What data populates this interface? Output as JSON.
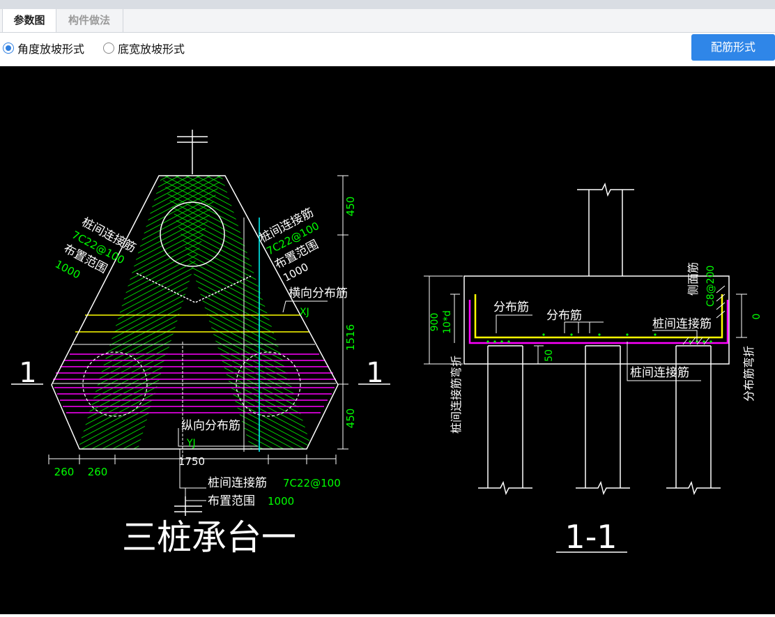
{
  "tabs": {
    "params": "参数图",
    "method": "构件做法"
  },
  "options": {
    "angle": "角度放坡形式",
    "width": "底宽放坡形式"
  },
  "button": {
    "rebar": "配筋形式"
  },
  "plan": {
    "tie_left_1": "桩间连接筋",
    "tie_left_2": "7C22@100",
    "tie_left_3": "布置范围",
    "tie_left_4": "1000",
    "tie_right_1": "桩间连接筋",
    "tie_right_2": "7C22@100",
    "tie_right_3": "布置范围",
    "tie_right_4": "1000",
    "trans_dist": "横向分布筋",
    "xj": "XJ",
    "long_dist": "纵向分布筋",
    "yj": "YJ",
    "dim_450_top": "450",
    "dim_1516": "1516",
    "dim_450_bot": "450",
    "dim_260a": "260",
    "dim_260b": "260",
    "dim_1750": "1750",
    "bottom_tie": "桩间连接筋",
    "bottom_tie_val": "7C22@100",
    "bottom_range": "布置范围",
    "bottom_range_val": "1000",
    "sec_left": "1",
    "sec_right": "1",
    "title": "三桩承台一"
  },
  "section": {
    "dist1": "分布筋",
    "dist2": "分布筋",
    "tie": "桩间连接筋",
    "side": "侧面筋",
    "side_val": "C8@200",
    "dim_900": "900",
    "dim_10d": "10*d",
    "dim_50": "50",
    "tie_bottom": "桩间连接筋",
    "left_vert": "桩间连接筋弯折",
    "right_vert": "分布筋弯折",
    "zero": "0",
    "title": "1-1"
  },
  "colors": {
    "accent": "#2f86e8",
    "green": "#00ff00",
    "magenta": "#ff00ff",
    "yellow": "#ffff00",
    "cyan": "#00ffff"
  }
}
